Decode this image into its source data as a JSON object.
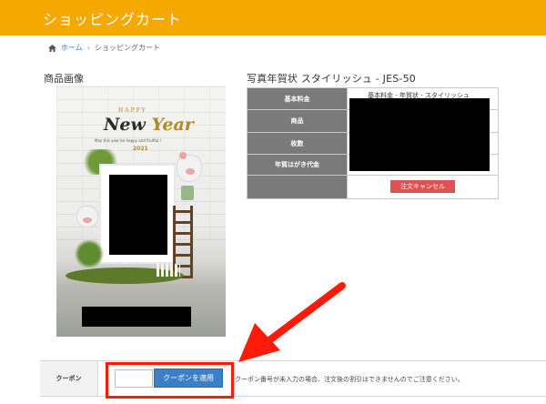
{
  "header": {
    "title": "ショッピングカート",
    "color": "#f5a900"
  },
  "breadcrumb": {
    "home_icon": "home-icon",
    "home": "ホーム",
    "separator": "›",
    "current": "ショッピングカート"
  },
  "product_image": {
    "label": "商品画像",
    "card_happy": "HAPPY",
    "card_new_year_1": "New",
    "card_new_year_2": "Year",
    "card_message": "May this year be happy and fruitful !",
    "card_year": "2021"
  },
  "product": {
    "title": "写真年賀状 スタイリッシュ - JES-50",
    "rows": [
      {
        "label": "基本料金",
        "value": "基本料金 - 年賀状 - スタイリッシュ"
      },
      {
        "label": "商品",
        "value": ""
      },
      {
        "label": "枚数",
        "value": ""
      },
      {
        "label": "年賀はがき代金",
        "value": ""
      },
      {
        "label": "",
        "value": ""
      }
    ],
    "cancel_label": "注文キャンセル"
  },
  "coupon": {
    "label": "クーポン",
    "input_value": "",
    "apply_label": "クーポンを適用",
    "note": "クーポン番号が未入力の場合、注文後の割引はできませんのでご注意ください。"
  },
  "annotation": {
    "arrow_color": "#ff1a0a"
  }
}
